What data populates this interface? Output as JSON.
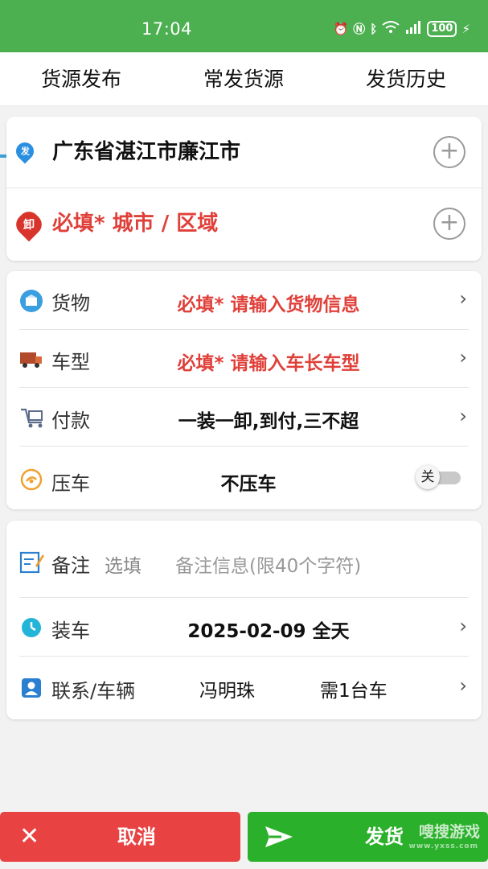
{
  "status_bar": {
    "time": "17:04",
    "battery": "100"
  },
  "tabs": [
    {
      "label": "货源发布",
      "active": true
    },
    {
      "label": "常发货源",
      "active": false
    },
    {
      "label": "发货历史",
      "active": false
    }
  ],
  "route": {
    "origin_badge": "发",
    "origin": "广东省湛江市廉江市",
    "dest_badge": "卸",
    "destination": "必填* 城市 / 区域"
  },
  "details": {
    "cargo": {
      "label": "货物",
      "value": "必填* 请输入货物信息"
    },
    "vehicle": {
      "label": "车型",
      "value": "必填* 请输入车长车型"
    },
    "payment": {
      "label": "付款",
      "value": "一装一卸,到付,三不超"
    },
    "detention": {
      "label": "压车",
      "value": "不压车",
      "toggle_label": "关",
      "toggle_on": false
    }
  },
  "extra": {
    "remark": {
      "label": "备注",
      "optional": "选填",
      "placeholder": "备注信息(限40个字符)"
    },
    "loading": {
      "label": "装车",
      "value": "2025-02-09 全天"
    },
    "contact": {
      "label": "联系/车辆",
      "name": "冯明珠",
      "vehicles": "需1台车"
    }
  },
  "actions": {
    "cancel_label": "取消",
    "submit_label": "发货"
  },
  "watermark": {
    "text": "嗖搜游戏",
    "url": "www.yxss.com"
  },
  "colors": {
    "status_bar": "#4caf50",
    "required_text": "#e0403a",
    "tab_indicator": "#3aa0d8",
    "cancel_button": "#e84242",
    "submit_button": "#2bb02b"
  }
}
